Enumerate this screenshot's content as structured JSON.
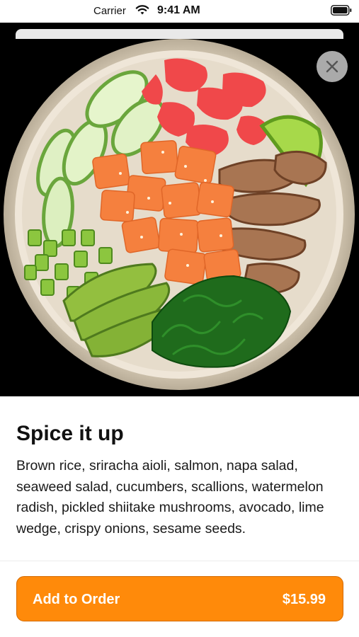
{
  "status_bar": {
    "carrier": "Carrier",
    "time": "9:41 AM",
    "icons": [
      "wifi-icon",
      "battery-icon"
    ]
  },
  "hero": {
    "image": "poke-bowl-photo",
    "close_icon": "close-icon"
  },
  "item": {
    "title": "Spice it up",
    "description": "Brown rice, sriracha aioli, salmon, napa salad, seaweed salad, cucumbers, scallions, watermelon radish, pickled shiitake mushrooms, avocado, lime wedge, crispy onions, sesame seeds."
  },
  "order_button": {
    "label": "Add to Order",
    "price": "$15.99"
  },
  "colors": {
    "accent": "#ff8a0a",
    "accent_border": "#d46a00",
    "hero_background": "#000000"
  }
}
